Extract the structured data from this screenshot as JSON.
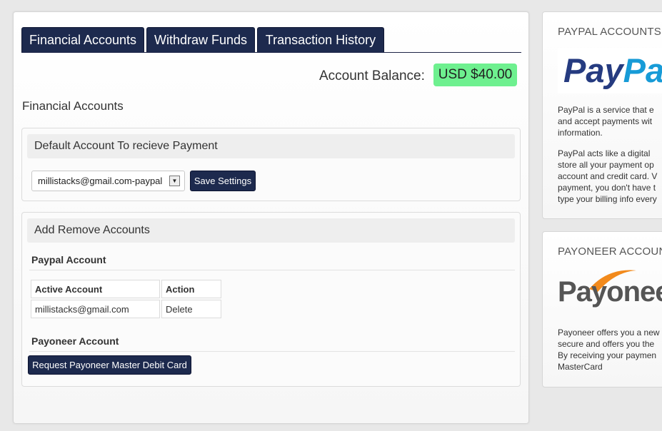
{
  "tabs": {
    "financial_accounts": "Financial Accounts",
    "withdraw_funds": "Withdraw Funds",
    "transaction_history": "Transaction History"
  },
  "balance": {
    "label": "Account Balance:",
    "value": "USD $40.00"
  },
  "section_title": "Financial Accounts",
  "default_account": {
    "header": "Default Account To recieve Payment",
    "selected_option": "millistacks@gmail.com-paypal",
    "save_label": "Save Settings"
  },
  "add_remove": {
    "header": "Add Remove Accounts",
    "paypal_title": "Paypal Account",
    "table": {
      "headers": [
        "Active Account",
        "Action"
      ],
      "rows": [
        [
          "millistacks@gmail.com",
          "Delete"
        ]
      ]
    },
    "payoneer_title": "Payoneer Account",
    "payoneer_button": "Request Payoneer Master Debit Card"
  },
  "sidebar": {
    "paypal": {
      "title": "PAYPAL ACCOUNTS",
      "logo_a": "Pay",
      "logo_b": "Pal",
      "para1": [
        "PayPal is a service that e",
        "and accept payments wit",
        "information."
      ],
      "para2": [
        "PayPal acts like a digital",
        "store all your payment op",
        "account and credit card. V",
        "payment, you don't have t",
        "type your billing info every"
      ]
    },
    "payoneer": {
      "title": "PAYONEER ACCOUNT",
      "logo_text": "Payonee",
      "para": [
        "Payoneer offers you a new",
        "secure and offers you the",
        "By receiving your paymen",
        "MasterCard"
      ]
    }
  },
  "colors": {
    "tab_bg": "#1d2a4e",
    "balance_bg": "#6ef08f",
    "paypal_dark": "#253b80",
    "paypal_light": "#179bd7",
    "payoneer_orange": "#f28a1c"
  }
}
